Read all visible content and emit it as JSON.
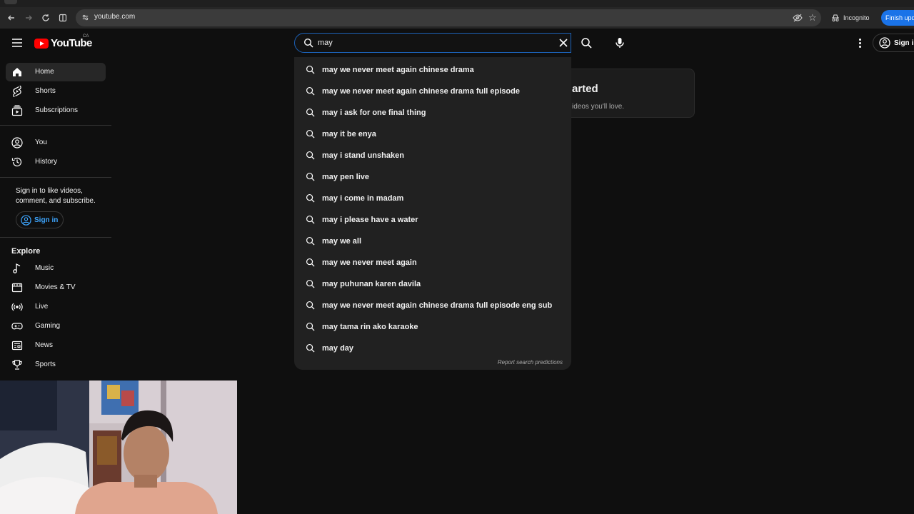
{
  "browser": {
    "url": "youtube.com",
    "incognito_label": "Incognito",
    "finish_update_label": "Finish update"
  },
  "header": {
    "logo_text": "YouTube",
    "region": "CA",
    "search_value": "may",
    "sign_in_label": "Sign in"
  },
  "sidebar": {
    "items": [
      {
        "label": "Home",
        "icon": "home-icon"
      },
      {
        "label": "Shorts",
        "icon": "shorts-icon"
      },
      {
        "label": "Subscriptions",
        "icon": "subscriptions-icon"
      },
      {
        "label": "You",
        "icon": "you-icon"
      },
      {
        "label": "History",
        "icon": "history-icon"
      }
    ],
    "signin_prompt": "Sign in to like videos, comment, and subscribe.",
    "signin_button": "Sign in",
    "explore_heading": "Explore",
    "explore_items": [
      {
        "label": "Music",
        "icon": "music-icon"
      },
      {
        "label": "Movies & TV",
        "icon": "movies-icon"
      },
      {
        "label": "Live",
        "icon": "live-icon"
      },
      {
        "label": "Gaming",
        "icon": "gaming-icon"
      },
      {
        "label": "News",
        "icon": "news-icon"
      },
      {
        "label": "Sports",
        "icon": "sports-icon"
      }
    ]
  },
  "card": {
    "title_partial": "arted",
    "subtitle_partial": "ideos you'll love."
  },
  "suggestions": [
    "may we never meet again chinese drama",
    "may we never meet again chinese drama full episode",
    "may i ask for one final thing",
    "may it be enya",
    "may i stand unshaken",
    "may pen live",
    "may i come in madam",
    "may i please have a water",
    "may we all",
    "may we never meet again",
    "may puhunan karen davila",
    "may we never meet again chinese drama full episode eng sub",
    "may tama rin ako karaoke",
    "may day"
  ],
  "report_label": "Report search predictions",
  "colors": {
    "background": "#0f0f0f",
    "dropdown": "#212121",
    "accent_blue": "#3ea6ff",
    "brand_red": "#ff0000"
  }
}
